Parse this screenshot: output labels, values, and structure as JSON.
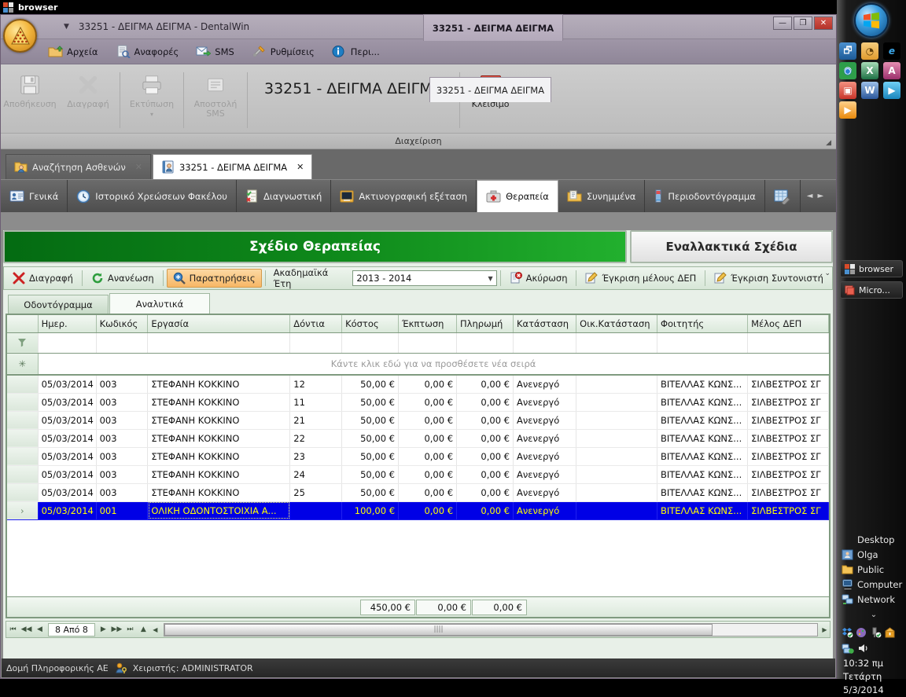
{
  "browser_window": {
    "title": "browser",
    "icon": "app-window-icon"
  },
  "dental_window": {
    "title": "33251 - ΔΕΙΓΜΑ ΔΕΙΓΜΑ - DentalWin",
    "minimize": "—",
    "maximize": "❐",
    "close": "✕",
    "floating_tab_top": "33251 - ΔΕΙΓΜΑ ΔΕΙΓΜΑ",
    "floating_tab_bottom": "33251 - ΔΕΙΓΜΑ ΔΕΙΓΜΑ",
    "collapse_arrow": "⌃"
  },
  "ribbon_menu": [
    {
      "label": "Αρχεία",
      "icon": "folder-up-icon"
    },
    {
      "label": "Αναφορές",
      "icon": "report-search-icon"
    },
    {
      "label": "SMS",
      "icon": "mail-arrow-icon"
    },
    {
      "label": "Ρυθμίσεις",
      "icon": "tools-icon"
    },
    {
      "label": "Περι...",
      "icon": "info-icon"
    }
  ],
  "ribbon_body": {
    "buttons": [
      {
        "label": "Αποθήκευση",
        "icon": "save-floppy-icon",
        "enabled": false
      },
      {
        "label": "Διαγραφή",
        "icon": "delete-x-icon",
        "enabled": false
      },
      {
        "label": "Εκτύπωση",
        "icon": "printer-icon",
        "enabled": false,
        "dropdown": "▾"
      },
      {
        "label": "Αποστολή SMS",
        "icon": "send-sms-icon",
        "enabled": false
      }
    ],
    "record_title": "33251 - ΔΕΙΓΜΑ ΔΕΙΓΜΑ",
    "close_label": "Κλείσιμο",
    "close_icon": "red-x-icon",
    "group_label": "Διαχείριση",
    "dialog_launcher": "◢"
  },
  "document_tabs": [
    {
      "label": "Αναζήτηση Ασθενών",
      "icon": "folder-person-icon",
      "active": false,
      "close": "✕"
    },
    {
      "label": "33251 - ΔΕΙΓΜΑ ΔΕΙΓΜΑ",
      "icon": "patient-card-icon",
      "active": true,
      "close": "✕"
    }
  ],
  "category_tabs": [
    {
      "label": "Γενικά",
      "icon": "id-card-icon",
      "active": false
    },
    {
      "label": "Ιστορικό Χρεώσεων Φακέλου",
      "icon": "clock-history-icon",
      "active": false
    },
    {
      "label": "Διαγνωστική",
      "icon": "checklist-icon",
      "active": false
    },
    {
      "label": "Ακτινογραφική εξέταση",
      "icon": "xray-screen-icon",
      "active": false
    },
    {
      "label": "Θεραπεία",
      "icon": "medical-kit-icon",
      "active": true
    },
    {
      "label": "Συνημμένα",
      "icon": "attachment-folder-icon",
      "active": false
    },
    {
      "label": "Περιοδοντόγραμμα",
      "icon": "perio-chart-icon",
      "active": false
    },
    {
      "label": "",
      "icon": "grid-wrench-icon",
      "active": false
    }
  ],
  "category_scroll": {
    "prev": "◄",
    "next": "►"
  },
  "banners": {
    "plan": "Σχέδιο Θεραπείας",
    "alternatives": "Εναλλακτικά Σχέδια"
  },
  "grid_toolbar": {
    "delete": {
      "label": "Διαγραφή",
      "icon": "red-x-icon"
    },
    "refresh": {
      "label": "Ανανέωση",
      "icon": "green-refresh-icon"
    },
    "remarks": {
      "label": "Παρατηρήσεις",
      "icon": "magnifier-plus-icon",
      "pressed": true
    },
    "years_label": "Ακαδημαϊκά Έτη",
    "years_value": "2013 - 2014",
    "years_caret": "▼",
    "cancel": {
      "label": "Ακύρωση",
      "icon": "page-cancel-icon"
    },
    "approve_member": {
      "label": "Έγκριση μέλους ΔΕΠ",
      "icon": "pencil-page-icon"
    },
    "approve_coordinator": {
      "label": "Έγκριση Συντονιστή",
      "icon": "pencil-page-icon"
    },
    "overflow": "⌄"
  },
  "sub_tabs": [
    {
      "label": "Οδοντόγραμμα",
      "active": false
    },
    {
      "label": "Αναλυτικά",
      "active": true
    }
  ],
  "grid": {
    "columns": [
      {
        "key": "ind",
        "label": "",
        "align": "left"
      },
      {
        "key": "date",
        "label": "Ημερ.",
        "align": "left"
      },
      {
        "key": "code",
        "label": "Κωδικός",
        "align": "left"
      },
      {
        "key": "work",
        "label": "Εργασία",
        "align": "left"
      },
      {
        "key": "teeth",
        "label": "Δόντια",
        "align": "left"
      },
      {
        "key": "cost",
        "label": "Κόστος",
        "align": "right"
      },
      {
        "key": "disc",
        "label": "Έκπτωση",
        "align": "right"
      },
      {
        "key": "pay",
        "label": "Πληρωμή",
        "align": "right"
      },
      {
        "key": "state",
        "label": "Κατάσταση",
        "align": "left"
      },
      {
        "key": "fstate",
        "label": "Οικ.Κατάσταση",
        "align": "left"
      },
      {
        "key": "stud",
        "label": "Φοιτητής",
        "align": "left"
      },
      {
        "key": "member",
        "label": "Μέλος ΔΕΠ",
        "align": "left"
      }
    ],
    "filter_icon": "filter-funnel-icon",
    "new_row_icon": "asterisk-icon",
    "new_row_text": "Κάντε κλικ εδώ για να προσθέσετε νέα σειρά",
    "selected_marker": "›",
    "rows": [
      {
        "date": "05/03/2014",
        "code": "003",
        "work": "ΣΤΕΦΑΝΗ ΚΟΚΚΙΝΟ",
        "teeth": "12",
        "cost": "50,00 €",
        "disc": "0,00 €",
        "pay": "0,00 €",
        "state": "Ανενεργό",
        "fstate": "",
        "stud": "ΒΙΤΕΛΛΑΣ ΚΩΝΣ...",
        "member": "ΣΙΛΒΕΣΤΡΟΣ ΣΓ",
        "selected": false
      },
      {
        "date": "05/03/2014",
        "code": "003",
        "work": "ΣΤΕΦΑΝΗ ΚΟΚΚΙΝΟ",
        "teeth": "11",
        "cost": "50,00 €",
        "disc": "0,00 €",
        "pay": "0,00 €",
        "state": "Ανενεργό",
        "fstate": "",
        "stud": "ΒΙΤΕΛΛΑΣ ΚΩΝΣ...",
        "member": "ΣΙΛΒΕΣΤΡΟΣ ΣΓ",
        "selected": false
      },
      {
        "date": "05/03/2014",
        "code": "003",
        "work": "ΣΤΕΦΑΝΗ ΚΟΚΚΙΝΟ",
        "teeth": "21",
        "cost": "50,00 €",
        "disc": "0,00 €",
        "pay": "0,00 €",
        "state": "Ανενεργό",
        "fstate": "",
        "stud": "ΒΙΤΕΛΛΑΣ ΚΩΝΣ...",
        "member": "ΣΙΛΒΕΣΤΡΟΣ ΣΓ",
        "selected": false
      },
      {
        "date": "05/03/2014",
        "code": "003",
        "work": "ΣΤΕΦΑΝΗ ΚΟΚΚΙΝΟ",
        "teeth": "22",
        "cost": "50,00 €",
        "disc": "0,00 €",
        "pay": "0,00 €",
        "state": "Ανενεργό",
        "fstate": "",
        "stud": "ΒΙΤΕΛΛΑΣ ΚΩΝΣ...",
        "member": "ΣΙΛΒΕΣΤΡΟΣ ΣΓ",
        "selected": false
      },
      {
        "date": "05/03/2014",
        "code": "003",
        "work": "ΣΤΕΦΑΝΗ ΚΟΚΚΙΝΟ",
        "teeth": "23",
        "cost": "50,00 €",
        "disc": "0,00 €",
        "pay": "0,00 €",
        "state": "Ανενεργό",
        "fstate": "",
        "stud": "ΒΙΤΕΛΛΑΣ ΚΩΝΣ...",
        "member": "ΣΙΛΒΕΣΤΡΟΣ ΣΓ",
        "selected": false
      },
      {
        "date": "05/03/2014",
        "code": "003",
        "work": "ΣΤΕΦΑΝΗ ΚΟΚΚΙΝΟ",
        "teeth": "24",
        "cost": "50,00 €",
        "disc": "0,00 €",
        "pay": "0,00 €",
        "state": "Ανενεργό",
        "fstate": "",
        "stud": "ΒΙΤΕΛΛΑΣ ΚΩΝΣ...",
        "member": "ΣΙΛΒΕΣΤΡΟΣ ΣΓ",
        "selected": false
      },
      {
        "date": "05/03/2014",
        "code": "003",
        "work": "ΣΤΕΦΑΝΗ ΚΟΚΚΙΝΟ",
        "teeth": "25",
        "cost": "50,00 €",
        "disc": "0,00 €",
        "pay": "0,00 €",
        "state": "Ανενεργό",
        "fstate": "",
        "stud": "ΒΙΤΕΛΛΑΣ ΚΩΝΣ...",
        "member": "ΣΙΛΒΕΣΤΡΟΣ ΣΓ",
        "selected": false
      },
      {
        "date": "05/03/2014",
        "code": "001",
        "work": "ΟΛΙΚΗ ΟΔΟΝΤΟΣΤΟΙΧΙΑ Α...",
        "teeth": "",
        "cost": "100,00 €",
        "disc": "0,00 €",
        "pay": "0,00 €",
        "state": "Ανενεργό",
        "fstate": "",
        "stud": "ΒΙΤΕΛΛΑΣ ΚΩΝΣ...",
        "member": "ΣΙΛΒΕΣΤΡΟΣ ΣΓ",
        "selected": true
      }
    ],
    "summary": [
      "450,00 €",
      "0,00 €",
      "0,00 €"
    ]
  },
  "navigator": {
    "first": "⏮",
    "prev_page": "◀◀",
    "prev": "◀",
    "page_text": "8 Από 8",
    "next": "▶",
    "next_page": "▶▶",
    "last": "⏭",
    "up": "▲",
    "scroll_left": "◀",
    "scroll_right": "▶",
    "thumb_grip": "||||"
  },
  "statusbar": {
    "company": "Δομή Πληροφορικής ΑΕ",
    "operator_icon": "user-key-icon",
    "operator": "Χειριστής: ADMINISTRATOR"
  },
  "sidebar": {
    "start_icon": "windows-orb-icon",
    "quick_launch": [
      {
        "name": "show-desktop-icon",
        "color": "#2a6bb0",
        "glyph": "🗗"
      },
      {
        "name": "outlook-icon",
        "color": "#f2a33c",
        "glyph": "◔"
      },
      {
        "name": "internet-explorer-icon",
        "color": "#1f7ec4",
        "glyph": "e"
      },
      {
        "name": "chrome-icon",
        "color": "#2e9e4a",
        "glyph": "◉"
      },
      {
        "name": "excel-icon",
        "color": "#1d7044",
        "glyph": "X"
      },
      {
        "name": "access-icon",
        "color": "#a4373a",
        "glyph": "A"
      },
      {
        "name": "photo-viewer-icon",
        "color": "#d3453b",
        "glyph": "▣"
      },
      {
        "name": "word-icon",
        "color": "#2b579a",
        "glyph": "W"
      },
      {
        "name": "media-player-icon",
        "color": "#29a3dc",
        "glyph": "▶"
      },
      {
        "name": "video-player-icon",
        "color": "#e8890c",
        "glyph": "▶"
      }
    ],
    "tasks": [
      {
        "label": "browser",
        "icon": "app-window-icon"
      },
      {
        "label": "Micro...",
        "icon": "photo-viewer-icon"
      }
    ],
    "places": [
      {
        "label": "Desktop",
        "icon": ""
      },
      {
        "label": "Olga",
        "icon": "user-folder-icon"
      },
      {
        "label": "Public",
        "icon": "folder-icon"
      },
      {
        "label": "Computer",
        "icon": "computer-icon"
      },
      {
        "label": "Network",
        "icon": "network-icon"
      }
    ],
    "places_more": "⌄",
    "tray_icons": [
      {
        "name": "dropbox-icon",
        "color": "#3d8ee0"
      },
      {
        "name": "paint-tray-icon",
        "color": "#8a6bbd"
      },
      {
        "name": "usb-safely-remove-icon",
        "color": "#8a8a8a"
      },
      {
        "name": "action-center-icon",
        "color": "#e39b20"
      }
    ],
    "tray_icons2": [
      {
        "name": "network-tray-icon",
        "color": "#4a90d0"
      },
      {
        "name": "volume-icon",
        "color": "#dddddd"
      }
    ],
    "clock": {
      "time": "10:32 πμ",
      "day": "Τετάρτη",
      "date": "5/3/2014"
    }
  }
}
